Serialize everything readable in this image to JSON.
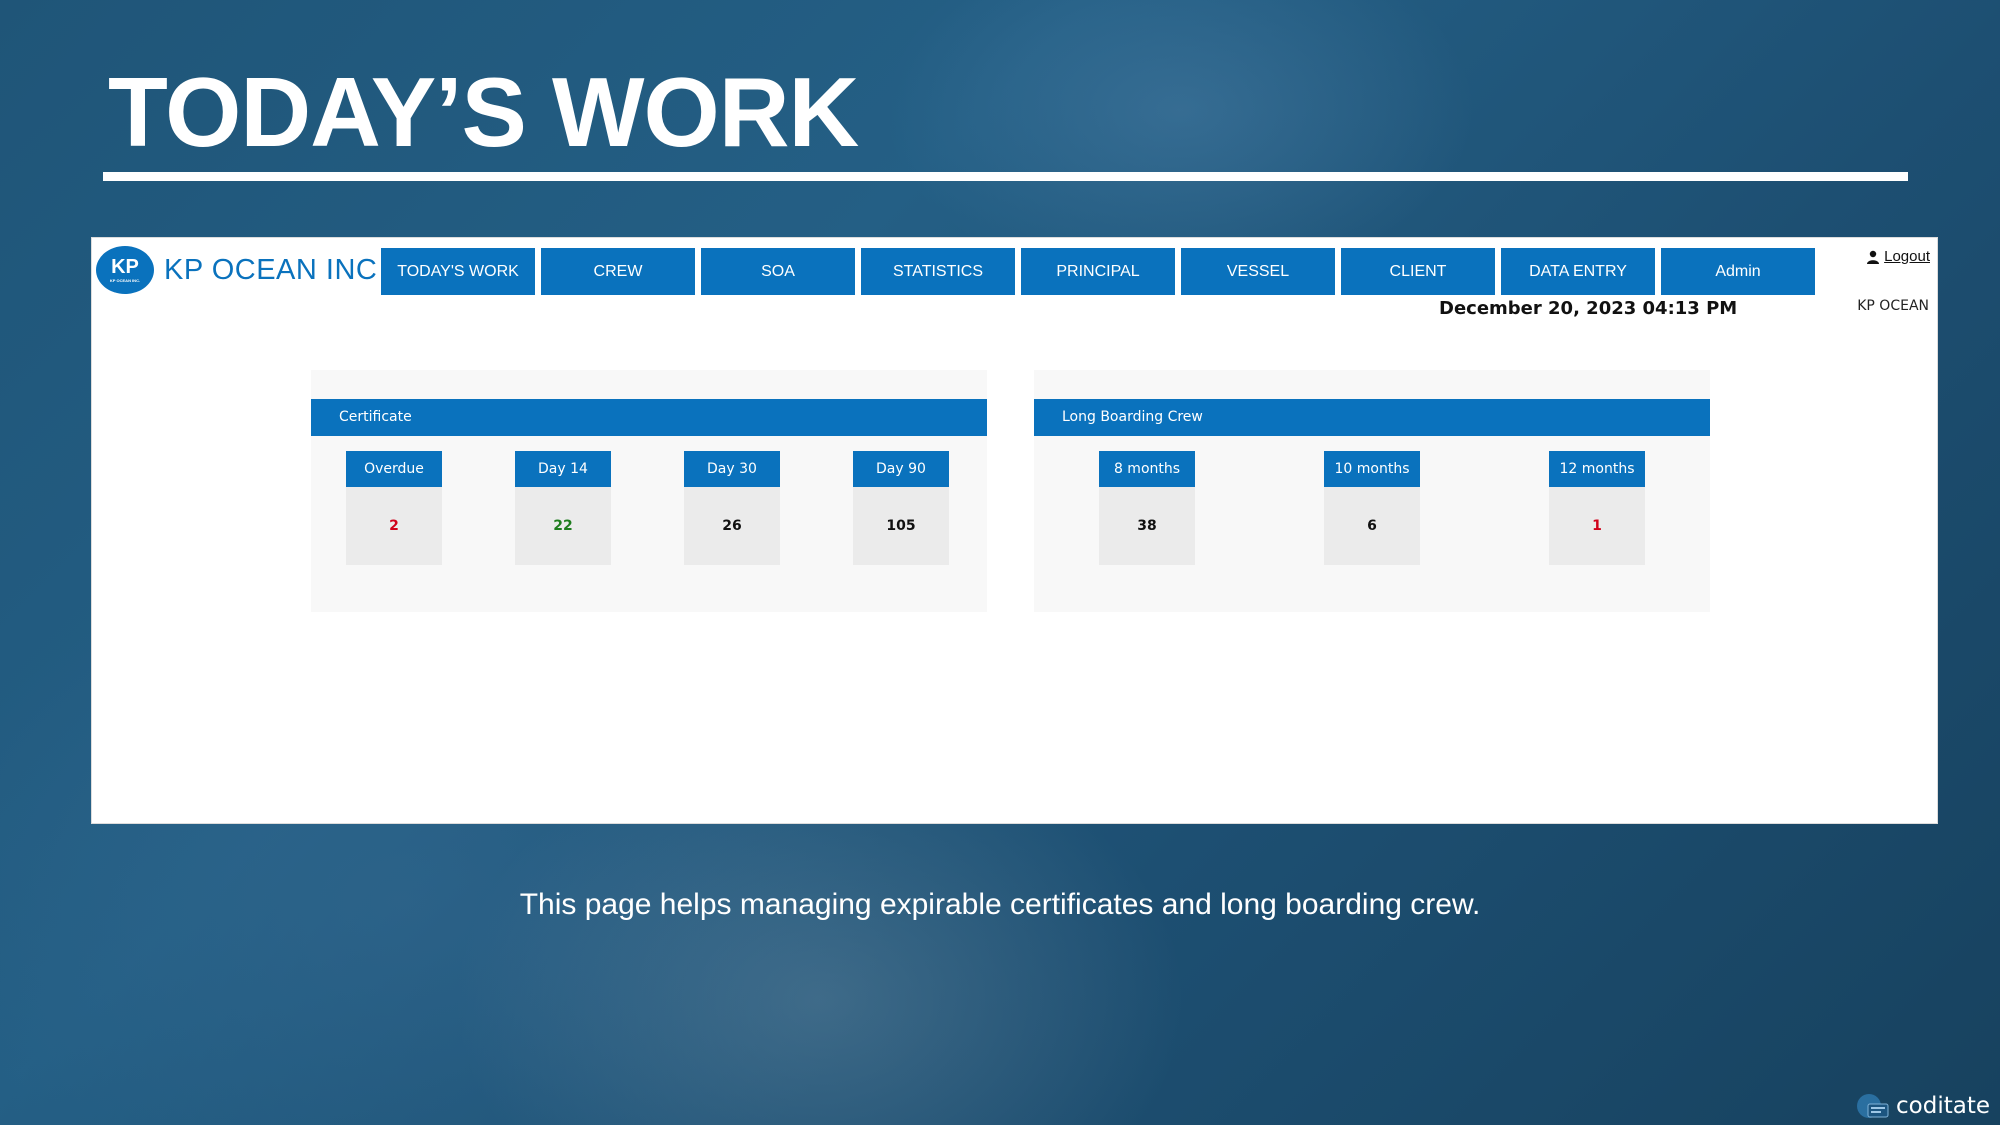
{
  "slide": {
    "title": "TODAY’S WORK",
    "caption": "This page helps managing expirable certificates and long boarding crew.",
    "brand": "coditate"
  },
  "app": {
    "logo": {
      "badge": "KP",
      "badge_sub": "KP OCEAN INC.",
      "text": "KP OCEAN INC"
    },
    "nav": [
      "TODAY'S WORK",
      "CREW",
      "SOA",
      "STATISTICS",
      "PRINCIPAL",
      "VESSEL",
      "CLIENT",
      "DATA ENTRY",
      "Admin"
    ],
    "logout_label": "Logout",
    "datetime": "December 20, 2023 04:13 PM",
    "company": "KP OCEAN"
  },
  "certificate": {
    "title": "Certificate",
    "items": [
      {
        "label": "Overdue",
        "value": "2",
        "color": "#d0021b"
      },
      {
        "label": "Day 14",
        "value": "22",
        "color": "#1e7d1e"
      },
      {
        "label": "Day 30",
        "value": "26",
        "color": "#111111"
      },
      {
        "label": "Day 90",
        "value": "105",
        "color": "#111111"
      }
    ]
  },
  "long_boarding": {
    "title": "Long Boarding Crew",
    "items": [
      {
        "label": "8 months",
        "value": "38",
        "color": "#111111"
      },
      {
        "label": "10 months",
        "value": "6",
        "color": "#111111"
      },
      {
        "label": "12 months",
        "value": "1",
        "color": "#d0021b"
      }
    ]
  },
  "colors": {
    "accent": "#0a72bd",
    "card_bg": "#ebebeb",
    "panel_bg": "#f8f8f8"
  }
}
